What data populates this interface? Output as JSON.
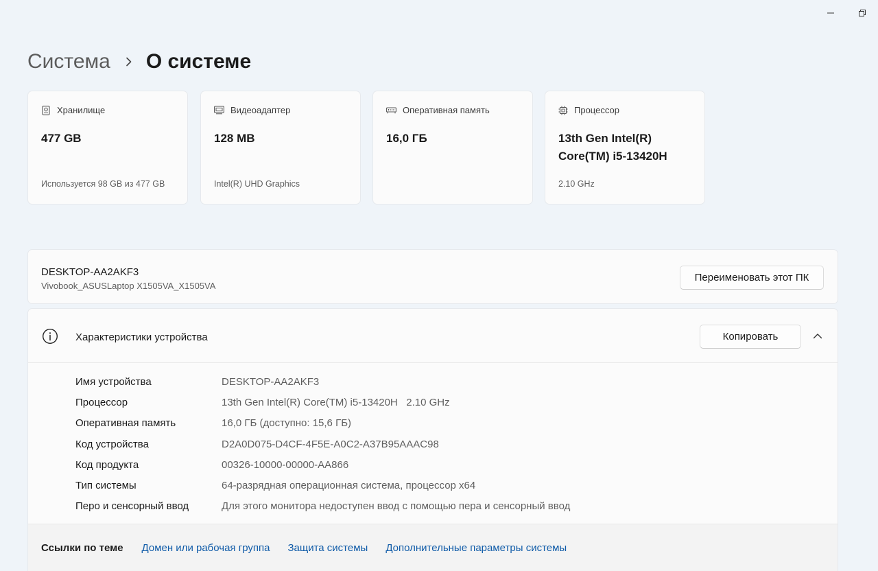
{
  "window_controls": {
    "minimize": "—",
    "restore": "⧉"
  },
  "breadcrumb": {
    "parent": "Система",
    "current": "О системе"
  },
  "cards": [
    {
      "icon": "storage-icon",
      "title": "Хранилище",
      "value": "477 GB",
      "sub": "Используется 98 GB из 477 GB"
    },
    {
      "icon": "display-adapter-icon",
      "title": "Видеоадаптер",
      "value": "128 MB",
      "sub": "Intel(R) UHD Graphics"
    },
    {
      "icon": "memory-icon",
      "title": "Оперативная память",
      "value": "16,0 ГБ",
      "sub": ""
    },
    {
      "icon": "processor-icon",
      "title": "Процессор",
      "value": "13th Gen Intel(R) Core(TM) i5-13420H",
      "sub": "2.10 GHz"
    }
  ],
  "device": {
    "name": "DESKTOP-AA2AKF3",
    "model": "Vivobook_ASUSLaptop X1505VA_X1505VA",
    "rename_label": "Переименовать этот ПК"
  },
  "specs": {
    "title": "Характеристики устройства",
    "copy_label": "Копировать",
    "rows": [
      {
        "label": "Имя устройства",
        "value": "DESKTOP-AA2AKF3"
      },
      {
        "label": "Процессор",
        "value": "13th Gen Intel(R) Core(TM) i5-13420H   2.10 GHz"
      },
      {
        "label": "Оперативная память",
        "value": "16,0 ГБ (доступно: 15,6 ГБ)"
      },
      {
        "label": "Код устройства",
        "value": "D2A0D075-D4CF-4F5E-A0C2-A37B95AAAC98"
      },
      {
        "label": "Код продукта",
        "value": "00326-10000-00000-AA866"
      },
      {
        "label": "Тип системы",
        "value": "64-разрядная операционная система, процессор x64"
      },
      {
        "label": "Перо и сенсорный ввод",
        "value": "Для этого монитора недоступен ввод с помощью пера и сенсорный ввод"
      }
    ]
  },
  "related_links": {
    "label": "Ссылки по теме",
    "links": [
      "Домен или рабочая группа",
      "Защита системы",
      "Дополнительные параметры системы"
    ]
  },
  "colors": {
    "background": "#eff4f9",
    "card": "#fbfbfb",
    "link": "#0f5ba8"
  }
}
